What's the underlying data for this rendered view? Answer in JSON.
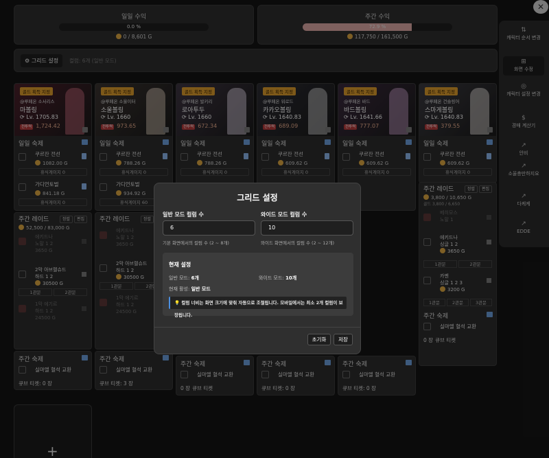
{
  "summary": {
    "daily": {
      "title": "일일 수익",
      "percent": "0.0 %",
      "progress": 0.0,
      "gold": "0 / 8,601 G"
    },
    "weekly": {
      "title": "주간 수익",
      "percent": "72.9 %",
      "progress": 0.729,
      "gold": "117,750 / 161,500 G"
    }
  },
  "toolbar": {
    "grid_button": "그리드 설정",
    "grid_info": "컬럼: 6개 (일반 모드)"
  },
  "sidebar": {
    "close": "✕",
    "items": [
      {
        "label": "캐릭터 순서 변경",
        "icon": "⇅"
      },
      {
        "label": "화면 수정",
        "icon": "⊞"
      },
      {
        "label": "캐릭터 설정 변경",
        "icon": "◎"
      },
      {
        "label": "경매 계산기",
        "icon": "$"
      },
      {
        "label": "안비",
        "icon": "↗"
      },
      {
        "label": "소울충만하지요",
        "icon": "↗"
      },
      {
        "label": "다케케",
        "icon": "↗"
      },
      {
        "label": "EDDE",
        "icon": "↗"
      }
    ]
  },
  "characters": [
    {
      "tag": "골드 획득 지정",
      "server": "@루페온 소서리스",
      "name": "마볼링",
      "level": "Lv. 1705.83",
      "power": "1,724.42",
      "powertag": "전투력"
    },
    {
      "tag": "골드 획득 지정",
      "server": "@루페온 소울이터",
      "name": "소울볼링",
      "level": "Lv. 1660",
      "power": "973.65",
      "powertag": "전투력"
    },
    {
      "tag": "골드 획득 지정",
      "server": "@루페온 발키리",
      "name": "로아투두",
      "level": "Lv. 1660",
      "power": "672.34",
      "powertag": "전투력"
    },
    {
      "tag": "골드 획득 지정",
      "server": "@루페온 워로드",
      "name": "카카오볼링",
      "level": "Lv. 1640.83",
      "power": "689.09",
      "powertag": "전투력"
    },
    {
      "tag": "골드 획득 지정",
      "server": "@루페온 바드",
      "name": "바드볼링",
      "level": "Lv. 1641.66",
      "power": "777.07",
      "powertag": "전투력"
    },
    {
      "tag": "골드 획득 지정",
      "server": "@루페온 건슬링어",
      "name": "스마게볼링",
      "level": "Lv. 1640.83",
      "power": "379.55",
      "powertag": "전투력"
    }
  ],
  "daily_sec": "일일 숙제",
  "daily_tasks": [
    {
      "name": "쿠르잔 전선",
      "gold": "1082.00 G"
    },
    {
      "name": "쿠르잔 전선",
      "gold": "788.26 G"
    },
    {
      "name": "쿠르잔 전선",
      "gold": "788.26 G"
    },
    {
      "name": "쿠르잔 전선",
      "gold": "609.62 G"
    },
    {
      "name": "쿠르잔 전선",
      "gold": "609.62 G"
    },
    {
      "name": "쿠르잔 전선",
      "gold": "609.62 G"
    }
  ],
  "rest": "휴식게이지 0",
  "guardian": {
    "name": "가디언토벌",
    "gold1": "841.18 G",
    "gold2": "934.92 G",
    "rest2": "휴식게이지 60"
  },
  "weekly_raid": {
    "title": "주간 레이드",
    "sort": "정렬",
    "edit": "편집",
    "gold1": "52,500 / 83,000 G",
    "gold6": "3,800 / 10,650 G",
    "gold6sub": "골드 3,800 / 6,650"
  },
  "raid_col1": [
    {
      "name": "에키드나",
      "sub": "노말 1 2",
      "gold": "3650 G"
    },
    {
      "name": "2막 아브렐슈드",
      "sub": "하드 1 2",
      "gold": "30500 G"
    },
    {
      "name": "1막 에기르",
      "sub": "하드 1 2",
      "gold": "24500 G"
    }
  ],
  "raid_col6": [
    {
      "name": "베히모스",
      "sub": "노말 1",
      "gold": ""
    },
    {
      "name": "에키드나",
      "sub": "싱글 1 2",
      "gold": "3650 G",
      "badge": "3650 G"
    },
    {
      "name": "카멘",
      "sub": "싱글 1 2 3",
      "gold": "3200 G",
      "badge": "3200 G"
    }
  ],
  "gates": {
    "g1": "1관문",
    "g2": "2관문",
    "g3": "3관문"
  },
  "weekly_sec": "주간 숙제",
  "weekly_task": "실마엘 혈석 교환",
  "ticket": "큐브 티켓: 0 장",
  "ticket3": "큐브 티켓: 3 장",
  "ticket_short": "큐브 티켓",
  "ticket_zero": "0 장",
  "add_plus": "+",
  "modal": {
    "title": "그리드 설정",
    "normal_label": "일반 모드 컬럼 수",
    "normal_value": "6",
    "normal_hint": "기본 화면에서의 컬럼 수 (2 ~ 8개)",
    "wide_label": "와이드 모드 컬럼 수",
    "wide_value": "10",
    "wide_hint": "와이드 화면에서의 컬럼 수 (2 ~ 12개)",
    "current_title": "현재 설정",
    "normal_mode_k": "일반 모드:",
    "normal_mode_v": "6개",
    "wide_mode_k": "와이드 모드:",
    "wide_mode_v": "10개",
    "active_k": "현재 활성:",
    "active_v": "일반 모드",
    "note": "💡 컬럼 너비는 화면 크기에 맞춰 자동으로 조절됩니다. 모바일에서는 최소 2개 컬럼이 보장됩니다.",
    "reset": "초기화",
    "save": "저장"
  },
  "colors": {
    "accent_gold": "#d99a2b",
    "progress": "#d9a6a2",
    "note_bar": "#4b8fe0"
  }
}
